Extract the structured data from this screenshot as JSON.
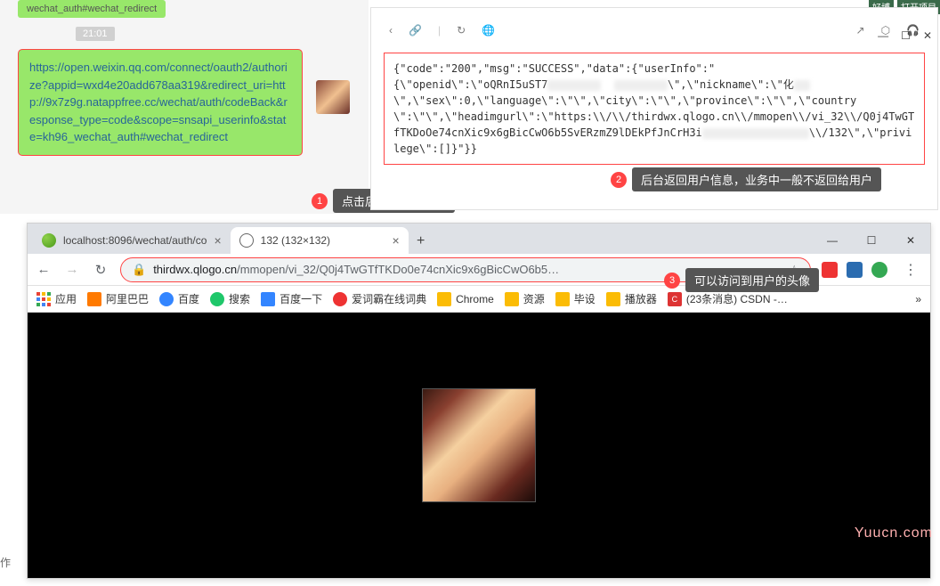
{
  "chat": {
    "top_msg": "wechat_auth#wechat_redirect",
    "timestamp": "21:01",
    "main_msg": "https://open.weixin.qq.com/connect/oauth2/authorize?appid=wxd4e20add678aa319&redirect_uri=http://9x7z9g.natappfree.cc/wechat/auth/codeBack&response_type=code&scope=snsapi_userinfo&state=kh96_wechat_auth#wechat_redirect"
  },
  "annotations": {
    "a1": "点击后后台获取信息",
    "a2": "后台返回用户信息，业务中一般不返回给用户",
    "a3": "可以访问到用户的头像"
  },
  "response": {
    "line1": "{\"code\":\"200\",\"msg\":\"SUCCESS\",\"data\":{\"userInfo\":\"",
    "line2a": "{\\\"openid\\\":\\\"oQRnI5uST7",
    "line2b": "\\\",\\\"nickname\\\":\\\"化",
    "line3": "\\\",\\\"sex\\\":0,\\\"language\\\":\\\"\\\",\\\"city\\\":\\\"\\\",\\\"province\\\":\\\"\\\",\\\"country\\\":\\\"\\\",\\\"headimgurl\\\":\\\"https:\\\\/\\\\/thirdwx.qlogo.cn\\\\/mmopen\\\\/vi_32\\\\/Q0j4TwGTfTKDoOe74cnXic9x6gBicCwO6b5SvERzmZ9lDEkPfJnCrH3i",
    "line4": "\\\\/132\\\",\\\"privilege\\\":[]}\"}}"
  },
  "topbar": {
    "i1": "好博",
    "i2": "打开项目",
    "i3": ""
  },
  "winctrl_small": {
    "min": "—",
    "max": "☐",
    "close": "✕"
  },
  "resp_toolbar": {
    "back": "‹",
    "link": "🔗",
    "reload": "↻",
    "globe": "🌐",
    "share": "↗",
    "cube": "⬡",
    "ear": "🎧"
  },
  "chrome": {
    "tabs": [
      {
        "title": "localhost:8096/wechat/auth/co"
      },
      {
        "title": "132 (132×132)"
      }
    ],
    "newtab": "+",
    "winctrl": {
      "min": "—",
      "max": "☐",
      "close": "✕"
    },
    "nav": {
      "back": "←",
      "fwd": "→",
      "reload": "↻"
    },
    "url_domain": "thirdwx.qlogo.cn",
    "url_path": "/mmopen/vi_32/Q0j4TwGTfTKDo0e74cnXic9x6gBicCwO6b5…",
    "lock": "🔒",
    "star": "☆",
    "menu": "⋮",
    "bookmarks": {
      "apps": "应用",
      "items": [
        "阿里巴巴",
        "百度",
        "搜索",
        "百度一下",
        "爱词霸在线词典",
        "Chrome",
        "资源",
        "毕设",
        "播放器",
        "(23条消息) CSDN -…"
      ],
      "overflow": "»"
    }
  },
  "watermark": "Yuucn.com",
  "side_cut": "作"
}
